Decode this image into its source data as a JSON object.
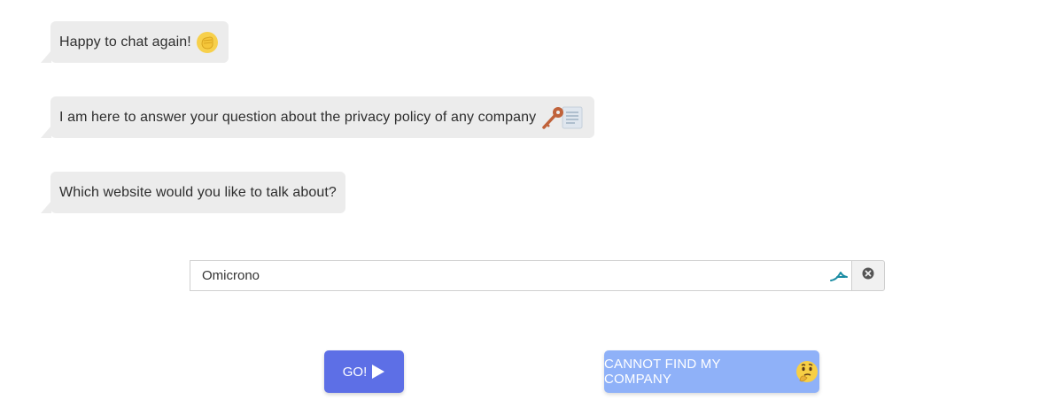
{
  "chat": {
    "messages": [
      {
        "text": "Happy to chat again!",
        "emoji": "raised-fist-icon"
      },
      {
        "text": "I am here to answer your question about the privacy policy of any company",
        "emoji": "key-and-document-icon"
      },
      {
        "text": "Which website would you like to talk about?"
      }
    ]
  },
  "search": {
    "value": "Omicrono",
    "extension_icon": "autofill-extension-icon",
    "clear_icon": "clear-circle-icon"
  },
  "buttons": {
    "go_label": "GO!",
    "go_icon": "play-icon",
    "cannot_label": "CANNOT FIND MY COMPANY",
    "cannot_icon": "thinking-face-icon"
  },
  "colors": {
    "bubble": "#ececec",
    "go_button": "#5d6fe6",
    "cannot_button": "#8fb1f8"
  }
}
